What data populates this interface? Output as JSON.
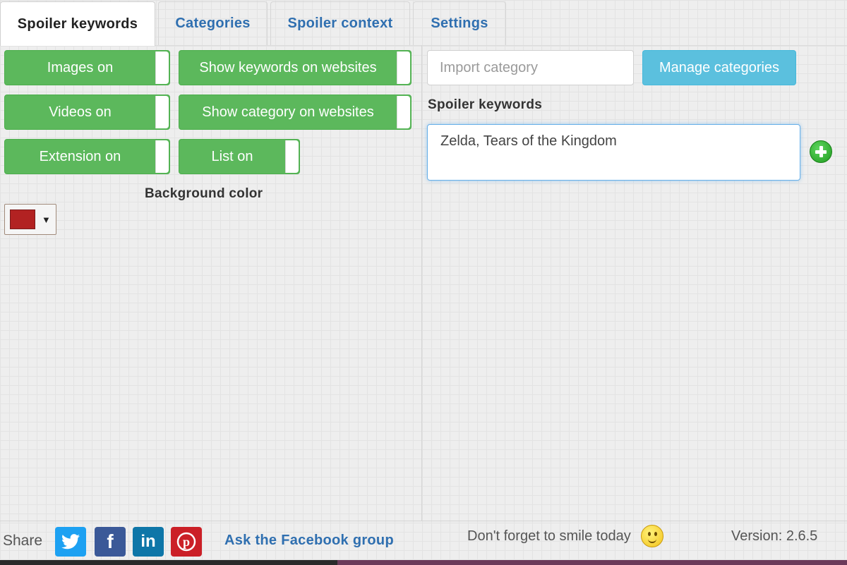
{
  "tabs": [
    {
      "label": "Spoiler keywords",
      "active": true
    },
    {
      "label": "Categories",
      "active": false
    },
    {
      "label": "Spoiler context",
      "active": false
    },
    {
      "label": "Settings",
      "active": false
    }
  ],
  "toggles": {
    "images": "Images on",
    "show_keywords": "Show keywords on websites",
    "videos": "Videos on",
    "show_category": "Show category on websites",
    "extension": "Extension on",
    "list": "List on"
  },
  "background_color": {
    "label": "Background color",
    "value": "#b22222"
  },
  "import": {
    "placeholder": "Import category"
  },
  "manage_button": "Manage categories",
  "keywords": {
    "label": "Spoiler keywords",
    "value": "Zelda, Tears of the Kingdom"
  },
  "footer": {
    "share_label": "Share",
    "social": [
      {
        "name": "twitter",
        "color": "#1da1f2"
      },
      {
        "name": "facebook",
        "color": "#3b5998"
      },
      {
        "name": "linkedin",
        "color": "#0e76a8"
      },
      {
        "name": "pinterest",
        "color": "#cb2027"
      }
    ],
    "facebook_group_link": "Ask the Facebook group",
    "smile_text": "Don't forget to smile today",
    "version": "Version: 2.6.5"
  }
}
